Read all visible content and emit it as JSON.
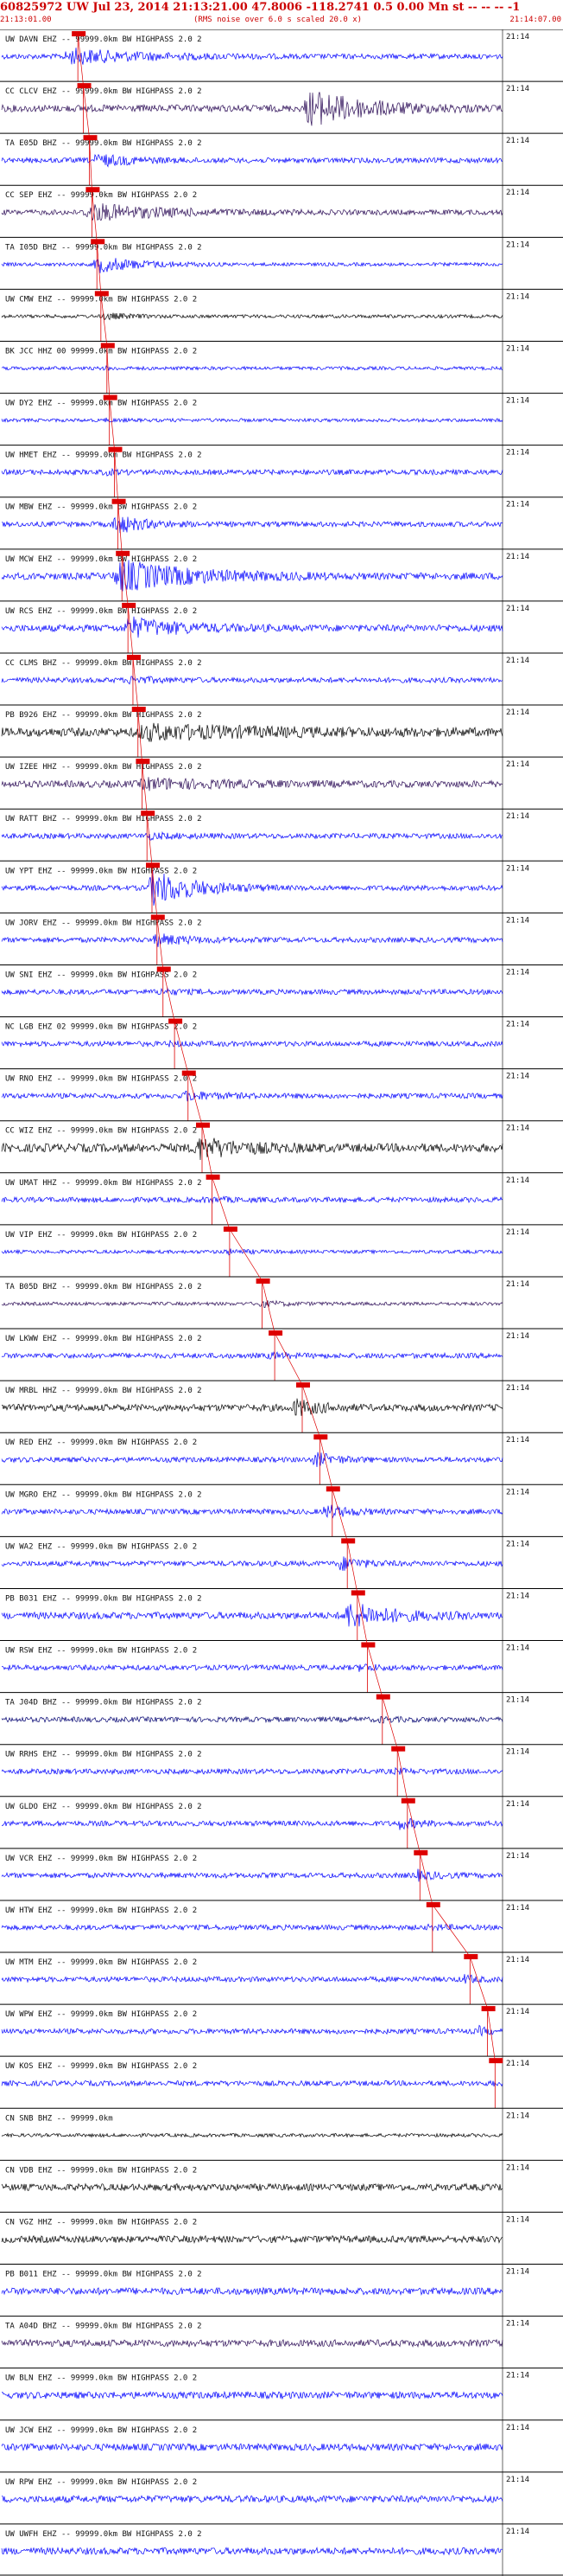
{
  "header": {
    "event_id": "60825972",
    "title_line": "60825972 UW Jul 23, 2014 21:13:21.00   47.8006 -118.2741  0.5 0.00 Mn st -- -- --  -1",
    "start_time": "21:13:01.00",
    "noise_note": "(RMS noise over 6.0 s scaled 20.0 x)",
    "end_time": "21:14:07.00"
  },
  "time_label": "21:14",
  "filter_suffix": "99999.0km BW  HIGHPASS  2.0  2",
  "colors": {
    "background": "#ffffff",
    "trace_blue": "#0000ff",
    "trace_black": "#000000",
    "trace_purple": "#2a0a55",
    "trace_navy": "#000070",
    "pick_red": "#dd0000",
    "text_red": "#cc0000",
    "label_grey": "#111111"
  },
  "stations": [
    {
      "label": "UW DAVN EHZ -- 99999.0km BW  HIGHPASS  2.0  2",
      "color": "#0000ff",
      "amp": 9,
      "noise": 3,
      "pick": 0.152,
      "burst": [
        0.12,
        0.55,
        1.0
      ]
    },
    {
      "label": "CC CLCV EHZ -- 99999.0km BW  HIGHPASS  2.0  2",
      "color": "#2a0a55",
      "amp": 14,
      "noise": 4,
      "pick": 0.163,
      "burst": [
        0.6,
        0.95,
        1.6
      ]
    },
    {
      "label": "TA E05D BHZ -- 99999.0km BW  HIGHPASS  2.0  2",
      "color": "#0000ff",
      "amp": 7,
      "noise": 3,
      "pick": 0.175,
      "burst": [
        0.18,
        0.4,
        1.0
      ]
    },
    {
      "label": "CC SEP EHZ -- 99999.0km BW  HIGHPASS  2.0  2",
      "color": "#2a0a55",
      "amp": 8,
      "noise": 3,
      "pick": 0.18,
      "burst": [
        0.16,
        0.6,
        1.3
      ]
    },
    {
      "label": "TA I05D BHZ -- 99999.0km BW  HIGHPASS  2.0  2",
      "color": "#0000ff",
      "amp": 10,
      "noise": 2,
      "pick": 0.19,
      "burst": [
        0.18,
        0.45,
        1.0
      ]
    },
    {
      "label": "UW CMW EHZ -- 99999.0km BW  HIGHPASS  2.0  2",
      "color": "#000000",
      "amp": 6,
      "noise": 2,
      "pick": 0.198,
      "burst": [
        0.2,
        0.35,
        0.6
      ]
    },
    {
      "label": "BK JCC HHZ 00 99999.0km BW  HIGHPASS  2.0  2",
      "color": "#0000ff",
      "amp": 4,
      "noise": 2,
      "pick": 0.21,
      "burst": [
        0.2,
        0.3,
        0.3
      ]
    },
    {
      "label": "UW DY2 EHZ -- 99999.0km BW  HIGHPASS  2.0  2",
      "color": "#0000ff",
      "amp": 4,
      "noise": 2,
      "pick": 0.215,
      "burst": [
        0.2,
        0.3,
        0.3
      ]
    },
    {
      "label": "UW HMET EHZ -- 99999.0km BW  HIGHPASS  2.0  2",
      "color": "#0000ff",
      "amp": 5,
      "noise": 3,
      "pick": 0.225,
      "burst": [
        0.2,
        0.3,
        0.4
      ]
    },
    {
      "label": "UW MBW EHZ -- 99999.0km BW  HIGHPASS  2.0  2",
      "color": "#0000ff",
      "amp": 12,
      "noise": 3,
      "pick": 0.232,
      "burst": [
        0.22,
        0.38,
        1.0
      ]
    },
    {
      "label": "UW MCW EHZ -- 99999.0km BW  HIGHPASS  2.0  2",
      "color": "#0000ff",
      "amp": 16,
      "noise": 4,
      "pick": 0.24,
      "burst": [
        0.22,
        0.65,
        1.2
      ]
    },
    {
      "label": "UW RCS EHZ -- 99999.0km BW  HIGHPASS  2.0  2",
      "color": "#0000ff",
      "amp": 12,
      "noise": 4,
      "pick": 0.252,
      "burst": [
        0.24,
        0.55,
        1.0
      ]
    },
    {
      "label": "CC CLMS BHZ -- 99999.0km BW  HIGHPASS  2.0  2",
      "color": "#0000ff",
      "amp": 6,
      "noise": 3,
      "pick": 0.262,
      "burst": [
        0.25,
        0.4,
        0.6
      ]
    },
    {
      "label": "PB B926 EHZ -- 99999.0km BW  HIGHPASS  2.0  2",
      "color": "#000000",
      "amp": 9,
      "noise": 5,
      "pick": 0.272,
      "burst": [
        0.26,
        0.95,
        0.9
      ]
    },
    {
      "label": "UW IZEE HHZ -- 99999.0km BW  HIGHPASS  2.0  2",
      "color": "#2a0a55",
      "amp": 7,
      "noise": 4,
      "pick": 0.28,
      "burst": [
        0.27,
        0.7,
        0.8
      ]
    },
    {
      "label": "UW RATT BHZ -- 99999.0km BW  HIGHPASS  2.0  2",
      "color": "#0000ff",
      "amp": 5,
      "noise": 3,
      "pick": 0.29,
      "burst": [
        0.28,
        0.5,
        0.5
      ]
    },
    {
      "label": "UW YPT EHZ -- 99999.0km BW  HIGHPASS  2.0  2",
      "color": "#0000ff",
      "amp": 16,
      "noise": 3,
      "pick": 0.3,
      "burst": [
        0.29,
        0.55,
        1.4
      ]
    },
    {
      "label": "UW JORV EHZ -- 99999.0km BW  HIGHPASS  2.0  2",
      "color": "#0000ff",
      "amp": 8,
      "noise": 3,
      "pick": 0.31,
      "burst": [
        0.3,
        0.5,
        0.8
      ]
    },
    {
      "label": "UW SNI EHZ -- 99999.0km BW  HIGHPASS  2.0  2",
      "color": "#0000ff",
      "amp": 5,
      "noise": 3,
      "pick": 0.322,
      "burst": [
        0.31,
        0.45,
        0.5
      ]
    },
    {
      "label": "NC LGB EHZ 02 99999.0km BW  HIGHPASS  2.0  2",
      "color": "#0000ff",
      "amp": 4,
      "noise": 3,
      "pick": 0.345,
      "burst": [
        0.33,
        0.45,
        0.4
      ]
    },
    {
      "label": "UW RNO EHZ -- 99999.0km BW  HIGHPASS  2.0  2",
      "color": "#0000ff",
      "amp": 7,
      "noise": 3,
      "pick": 0.372,
      "burst": [
        0.36,
        0.55,
        0.7
      ]
    },
    {
      "label": "CC WIZ EHZ -- 99999.0km BW  HIGHPASS  2.0  2",
      "color": "#000000",
      "amp": 12,
      "noise": 5,
      "pick": 0.4,
      "burst": [
        0.38,
        0.65,
        1.0
      ]
    },
    {
      "label": "UW UMAT HHZ -- 99999.0km BW  HIGHPASS  2.0  2",
      "color": "#0000ff",
      "amp": 5,
      "noise": 3,
      "pick": 0.42,
      "burst": [
        0.4,
        0.55,
        0.4
      ]
    },
    {
      "label": "UW VIP EHZ -- 99999.0km BW  HIGHPASS  2.0  2",
      "color": "#0000ff",
      "amp": 5,
      "noise": 2,
      "pick": 0.455,
      "burst": [
        0.44,
        0.6,
        0.5
      ]
    },
    {
      "label": "TA B05D BHZ -- 99999.0km BW  HIGHPASS  2.0  2",
      "color": "#2a0a55",
      "amp": 6,
      "noise": 2,
      "pick": 0.52,
      "burst": [
        0.51,
        0.65,
        0.6
      ]
    },
    {
      "label": "UW LKWW EHZ -- 99999.0km BW  HIGHPASS  2.0  2",
      "color": "#0000ff",
      "amp": 5,
      "noise": 3,
      "pick": 0.545,
      "burst": [
        0.53,
        0.65,
        0.5
      ]
    },
    {
      "label": "UW MRBL HHZ -- 99999.0km BW  HIGHPASS  2.0  2",
      "color": "#000000",
      "amp": 10,
      "noise": 4,
      "pick": 0.6,
      "burst": [
        0.58,
        0.72,
        1.0
      ]
    },
    {
      "label": "UW RED EHZ -- 99999.0km BW  HIGHPASS  2.0  2",
      "color": "#0000ff",
      "amp": 9,
      "noise": 3,
      "pick": 0.635,
      "burst": [
        0.62,
        0.75,
        0.9
      ]
    },
    {
      "label": "UW MGRO EHZ -- 99999.0km BW  HIGHPASS  2.0  2",
      "color": "#0000ff",
      "amp": 9,
      "noise": 3,
      "pick": 0.66,
      "burst": [
        0.64,
        0.78,
        0.9
      ]
    },
    {
      "label": "UW WA2 EHZ -- 99999.0km BW  HIGHPASS  2.0  2",
      "color": "#0000ff",
      "amp": 9,
      "noise": 3,
      "pick": 0.69,
      "burst": [
        0.67,
        0.8,
        0.9
      ]
    },
    {
      "label": "PB B031 EHZ -- 99999.0km BW  HIGHPASS  2.0  2",
      "color": "#0000ff",
      "amp": 14,
      "noise": 4,
      "pick": 0.71,
      "burst": [
        0.68,
        0.95,
        1.1
      ]
    },
    {
      "label": "UW RSW EHZ -- 99999.0km BW  HIGHPASS  2.0  2",
      "color": "#0000ff",
      "amp": 6,
      "noise": 3,
      "pick": 0.73,
      "burst": [
        0.71,
        0.82,
        0.6
      ]
    },
    {
      "label": "TA J04D BHZ -- 99999.0km BW  HIGHPASS  2.0  2",
      "color": "#000070",
      "amp": 5,
      "noise": 3,
      "pick": 0.76,
      "burst": [
        0.75,
        0.85,
        0.4
      ]
    },
    {
      "label": "UW RRHS EHZ -- 99999.0km BW  HIGHPASS  2.0  2",
      "color": "#0000ff",
      "amp": 5,
      "noise": 3,
      "pick": 0.79,
      "burst": [
        0.78,
        0.88,
        0.4
      ]
    },
    {
      "label": "UW GLDO EHZ -- 99999.0km BW  HIGHPASS  2.0  2",
      "color": "#0000ff",
      "amp": 8,
      "noise": 3,
      "pick": 0.81,
      "burst": [
        0.79,
        0.9,
        0.8
      ]
    },
    {
      "label": "UW VCR EHZ -- 99999.0km BW  HIGHPASS  2.0  2",
      "color": "#0000ff",
      "amp": 8,
      "noise": 3,
      "pick": 0.835,
      "burst": [
        0.82,
        0.93,
        0.8
      ]
    },
    {
      "label": "UW HTW EHZ -- 99999.0km BW  HIGHPASS  2.0  2",
      "color": "#0000ff",
      "amp": 5,
      "noise": 3,
      "pick": 0.86,
      "burst": [
        0.85,
        0.95,
        0.5
      ]
    },
    {
      "label": "UW MTM EHZ -- 99999.0km BW  HIGHPASS  2.0  2",
      "color": "#0000ff",
      "amp": 7,
      "noise": 3,
      "pick": 0.935,
      "burst": [
        0.92,
        0.99,
        0.7
      ]
    },
    {
      "label": "UW WPW EHZ -- 99999.0km BW  HIGHPASS  2.0  2",
      "color": "#0000ff",
      "amp": 7,
      "noise": 3,
      "pick": 0.97,
      "burst": [
        0.95,
        1.0,
        0.7
      ]
    },
    {
      "label": "UW KOS EHZ -- 99999.0km BW  HIGHPASS  2.0  2",
      "color": "#0000ff",
      "amp": 5,
      "noise": 3,
      "pick": 0.985,
      "burst": [
        0.98,
        1.0,
        0.4
      ]
    },
    {
      "label": "CN SNB BHZ -- 99999.0km",
      "color": "#000000",
      "amp": 2,
      "noise": 2,
      "pick": null,
      "burst": null
    },
    {
      "label": "CN VDB EHZ -- 99999.0km BW  HIGHPASS  2.0  2",
      "color": "#000000",
      "amp": 4,
      "noise": 4,
      "pick": null,
      "burst": null
    },
    {
      "label": "CN VGZ HHZ -- 99999.0km BW  HIGHPASS  2.0  2",
      "color": "#000000",
      "amp": 4,
      "noise": 4,
      "pick": null,
      "burst": null
    },
    {
      "label": "PB B011 EHZ -- 99999.0km BW  HIGHPASS  2.0  2",
      "color": "#0000ff",
      "amp": 4,
      "noise": 4,
      "pick": null,
      "burst": null
    },
    {
      "label": "TA A04D BHZ -- 99999.0km BW  HIGHPASS  2.0  2",
      "color": "#2a0a55",
      "amp": 4,
      "noise": 4,
      "pick": null,
      "burst": null
    },
    {
      "label": "UW BLN EHZ -- 99999.0km BW  HIGHPASS  2.0  2",
      "color": "#0000ff",
      "amp": 4,
      "noise": 4,
      "pick": null,
      "burst": null
    },
    {
      "label": "UW JCW EHZ -- 99999.0km BW  HIGHPASS  2.0  2",
      "color": "#0000ff",
      "amp": 4,
      "noise": 4,
      "pick": null,
      "burst": null
    },
    {
      "label": "UW RPW EHZ -- 99999.0km BW  HIGHPASS  2.0  2",
      "color": "#0000ff",
      "amp": 4,
      "noise": 4,
      "pick": null,
      "burst": null
    },
    {
      "label": "UW UWFH EHZ -- 99999.0km BW  HIGHPASS  2.0  2",
      "color": "#0000ff",
      "amp": 4,
      "noise": 4,
      "pick": null,
      "burst": null
    }
  ]
}
